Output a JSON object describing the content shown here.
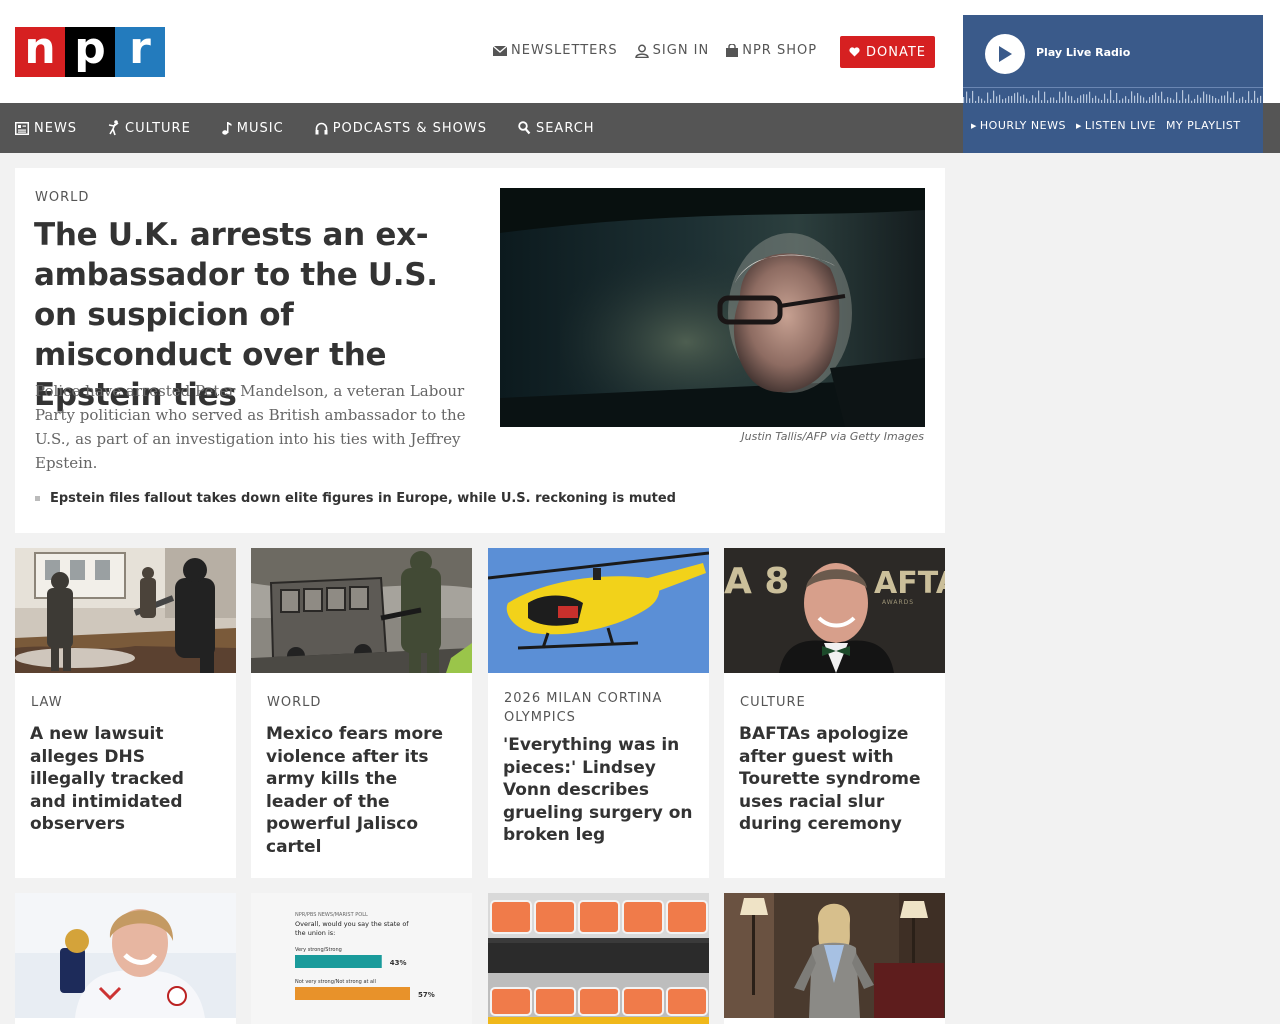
{
  "logo": {
    "letters": [
      "n",
      "p",
      "r"
    ]
  },
  "utility": {
    "newsletters": "NEWSLETTERS",
    "sign_in": "SIGN IN",
    "shop": "NPR SHOP",
    "donate": "DONATE"
  },
  "nav": {
    "news": "NEWS",
    "culture": "CULTURE",
    "music": "MUSIC",
    "podcasts": "PODCASTS & SHOWS",
    "search": "SEARCH"
  },
  "radio": {
    "play_label": "Play Live Radio",
    "hourly": "HOURLY NEWS",
    "listen": "LISTEN LIVE",
    "playlist": "MY PLAYLIST"
  },
  "hero": {
    "slug": "WORLD",
    "title": "The U.K. arrests an ex-ambassador to the U.S. on suspicion of misconduct over the Epstein ties",
    "teaser": "Police have arrested Peter Mandelson, a veteran Labour Party politician who served as British ambassador to the U.S., as part of an investigation into his ties with Jeffrey Epstein.",
    "credit": "Justin Tallis/AFP via Getty Images",
    "related": "Epstein files fallout takes down elite figures in Europe, while U.S. reckoning is muted"
  },
  "cards": [
    {
      "slug": "LAW",
      "title": "A new lawsuit alleges DHS illegally tracked and intimidated observers"
    },
    {
      "slug": "WORLD",
      "title": "Mexico fears more violence after its army kills the leader of the powerful Jalisco cartel"
    },
    {
      "slug": "2026 MILAN CORTINA OLYMPICS",
      "title": "'Everything was in pieces:' Lindsey Vonn describes grueling surgery on broken leg"
    },
    {
      "slug": "CULTURE",
      "title": "BAFTAs apologize after guest with Tourette syndrome uses racial slur during ceremony"
    }
  ],
  "thumb_text": {
    "bafta_left": "A 8",
    "bafta_right": "AFTA",
    "bafta_sub": "AWARDS"
  },
  "poll": {
    "source": "NPR/PBS NEWS/MARIST POLL",
    "question": "Overall, would you say the state of the union is:",
    "bars": [
      {
        "label": "Very strong/Strong",
        "value": 43,
        "display": "43%",
        "color": "#1a9b9b"
      },
      {
        "label": "Not very strong/Not strong at all",
        "value": 57,
        "display": "57%",
        "color": "#e8922a"
      }
    ]
  },
  "colors": {
    "npr_red": "#d62021",
    "npr_blue": "#237bbd",
    "nav_gray": "#555555",
    "radio_blue": "#3a5a8a"
  }
}
